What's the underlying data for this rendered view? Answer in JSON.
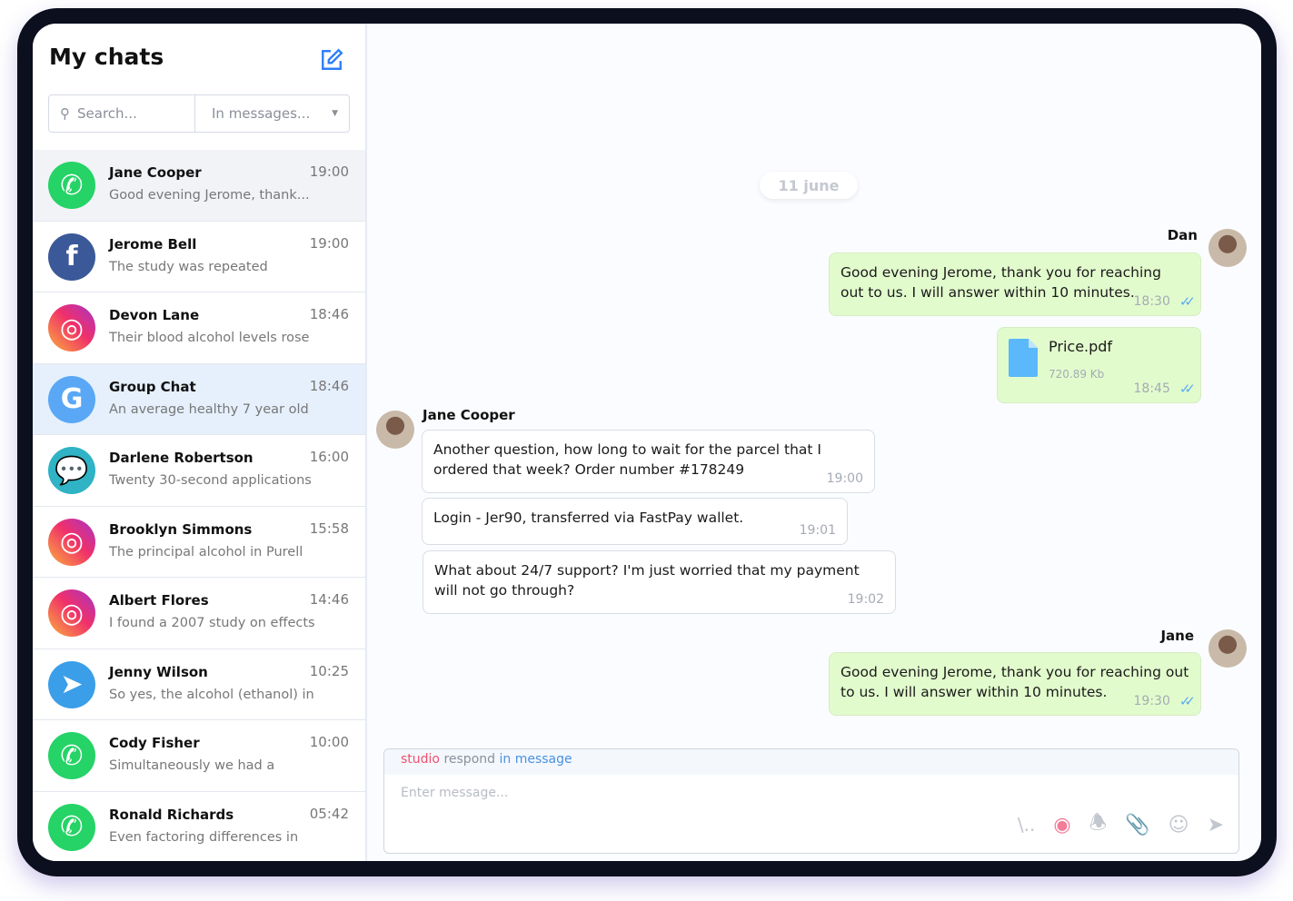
{
  "sidebar": {
    "title": "My chats",
    "search_placeholder": "Search...",
    "filter": "In messages...",
    "chats": [
      {
        "name": "Jane Cooper",
        "time": "19:00",
        "preview": "Good evening Jerome, thank...",
        "source": "whatsapp"
      },
      {
        "name": "Jerome Bell",
        "time": "19:00",
        "preview": "The study was repeated",
        "source": "facebook"
      },
      {
        "name": "Devon Lane",
        "time": "18:46",
        "preview": "Their blood alcohol levels rose",
        "source": "instagram"
      },
      {
        "name": "Group Chat",
        "time": "18:46",
        "preview": "An average healthy 7 year old",
        "source": "google"
      },
      {
        "name": "Darlene Robertson",
        "time": "16:00",
        "preview": "Twenty 30-second applications",
        "source": "chat"
      },
      {
        "name": "Brooklyn Simmons",
        "time": "15:58",
        "preview": "The principal alcohol in Purell",
        "source": "instagram"
      },
      {
        "name": "Albert Flores",
        "time": "14:46",
        "preview": "I found a 2007 study on effects",
        "source": "instagram"
      },
      {
        "name": "Jenny Wilson",
        "time": "10:25",
        "preview": "So yes, the alcohol (ethanol) in",
        "source": "telegram"
      },
      {
        "name": "Cody Fisher",
        "time": "10:00",
        "preview": "Simultaneously we had a",
        "source": "whatsapp"
      },
      {
        "name": "Ronald Richards",
        "time": "05:42",
        "preview": "Even factoring differences in",
        "source": "whatsapp"
      }
    ]
  },
  "chat": {
    "date": "11 june",
    "dan": {
      "name": "Dan",
      "msg1": "Good evening Jerome, thank you for reaching out to us. I will answer within 10 minutes.",
      "time1": "18:30",
      "file": "Price.pdf",
      "size": "720.89 Kb",
      "time2": "18:45"
    },
    "jane_cooper": {
      "name": "Jane Cooper",
      "msgs": [
        {
          "text": "Another question, how long to wait for the parcel that I ordered that week? Order number #178249",
          "time": "19:00"
        },
        {
          "text": "Login - Jer90, transferred via FastPay wallet.",
          "time": "19:01"
        },
        {
          "text": "What about 24/7 support? I'm just worried that my payment will not go through?",
          "time": "19:02"
        }
      ]
    },
    "jane": {
      "name": "Jane",
      "msg": "Good evening Jerome, thank you for reaching out to us. I will answer within 10 minutes.",
      "time": "19:30"
    },
    "composer": {
      "hint_a": "studio",
      "hint_b": "respond",
      "hint_c": "in message",
      "placeholder": "Enter message..."
    }
  },
  "colors": {
    "whatsapp": "#25d366",
    "facebook": "#3b5998",
    "google": "#5aa8f5",
    "chat": "#2fb3c5",
    "telegram": "#3a9ee8",
    "accent": "#2d7ff9",
    "bubble_out": "#e2fbcd"
  }
}
